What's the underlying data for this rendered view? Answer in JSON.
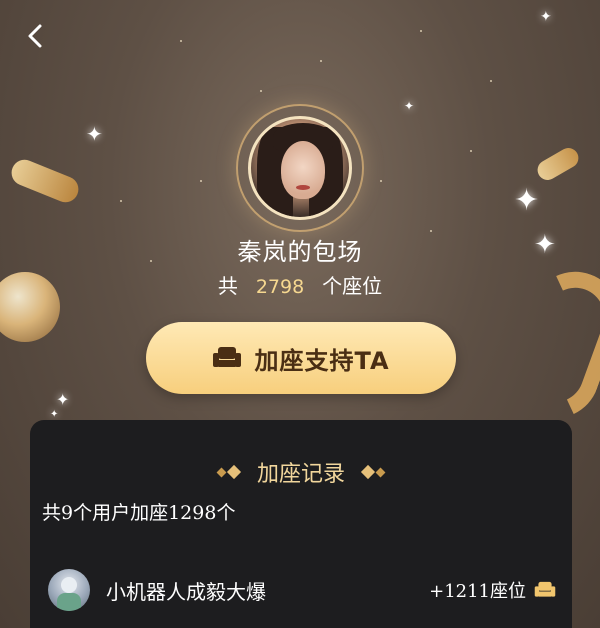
{
  "header": {
    "back_icon": "chevron-left-icon"
  },
  "host": {
    "name": "秦岚的包场",
    "seat_prefix": "共",
    "seat_count": "2798",
    "seat_suffix": "个座位"
  },
  "cta": {
    "label": "加座支持TA",
    "icon": "sofa-icon"
  },
  "records": {
    "title": "加座记录",
    "summary": "共9个用户加座1298个",
    "items": [
      {
        "name": "小机器人成毅大爆",
        "count": "+1211座位",
        "icon": "sofa-icon"
      }
    ]
  },
  "colors": {
    "accent_gold": "#f6d890",
    "button_gold": "#f7cf7d",
    "panel_bg": "#1d1d1f",
    "title_gold": "#f1d69c"
  }
}
